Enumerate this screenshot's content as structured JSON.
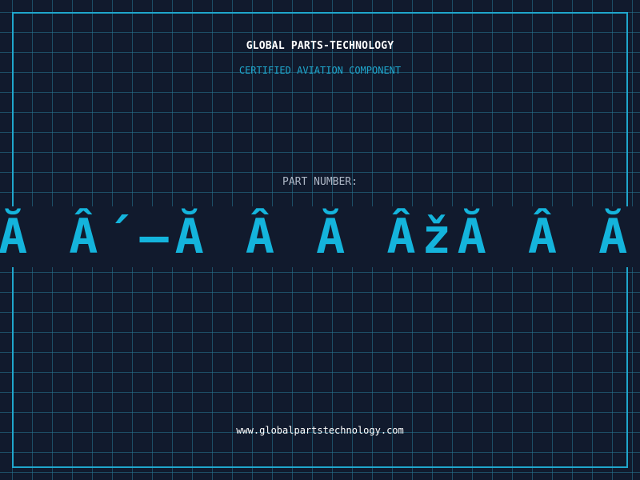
{
  "header": {
    "company_name": "GLOBAL PARTS-TECHNOLOGY",
    "certification_text": "CERTIFIED AVIATION COMPONENT"
  },
  "part": {
    "label": "PART NUMBER:",
    "number_text": "Ă Â´—Ă Â Ă ÂžĂ Â Ă"
  },
  "footer": {
    "website_url": "www.globalpartstechnology.com"
  },
  "colors": {
    "background": "#111a2d",
    "grid_line": "#1f5f78",
    "frame": "#1fa6cc",
    "accent": "#14b4dc",
    "title": "#ffffff",
    "label": "#aeb7c6"
  }
}
